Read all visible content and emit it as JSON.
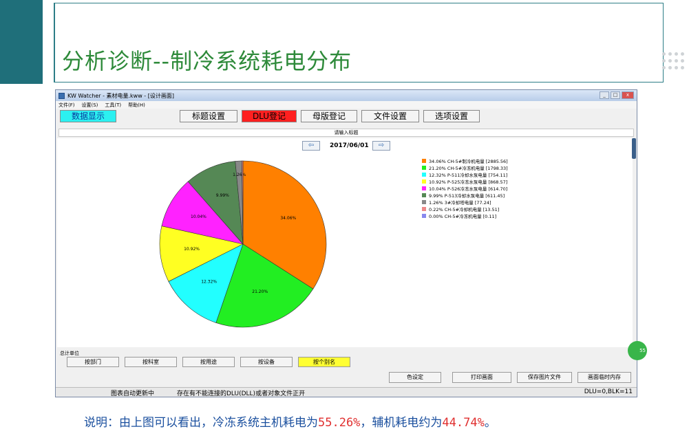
{
  "slide": {
    "title": "分析诊断--制冷系统耗电分布",
    "note_prefix": "说明：由上图可以看出，冷冻系统主机耗电为",
    "note_value1": "55.26%",
    "note_mid": "，辅机耗电约为",
    "note_value2": "44.74%",
    "note_suffix": "。"
  },
  "window": {
    "title": "KW Watcher - 素材电量.kww - [设计画面]",
    "controls": [
      "_",
      "□",
      "x"
    ],
    "menu": [
      "文件(F)",
      "设置(S)",
      "工具(T)",
      "帮助(H)"
    ],
    "toolbar": {
      "data_display": "数据显示",
      "title_settings": "标题设置",
      "dlu_register": "DLU登记",
      "master_register": "母版登记",
      "file_settings": "文件设置",
      "option_settings": "选项设置"
    },
    "hint": "请输入标题",
    "date": "2017/06/01",
    "prev_icon": "⇦",
    "next_icon": "⇨"
  },
  "chart_data": {
    "type": "pie",
    "slices": [
      {
        "label": "34.06% CH-5#制冷机电量 [2885.56]",
        "value": 34.06,
        "pct_label": "34.06%",
        "color": "#ff8000"
      },
      {
        "label": "21.20% CH-5#冷冻机电量 [1798.33]",
        "value": 21.2,
        "pct_label": "21.20%",
        "color": "#22ee22"
      },
      {
        "label": "12.32% P-511冷却水泵电量 [754.11]",
        "value": 12.32,
        "pct_label": "12.32%",
        "color": "#22ffff"
      },
      {
        "label": "10.92% P-525冷冻水泵电量 [868.57]",
        "value": 10.92,
        "pct_label": "10.92%",
        "color": "#ffff22"
      },
      {
        "label": "10.04% P-526冷冻水泵电量 [614.70]",
        "value": 10.04,
        "pct_label": "10.04%",
        "color": "#ff22ff"
      },
      {
        "label": "9.99% P-513冷却水泵电量 [611.45]",
        "value": 9.99,
        "pct_label": "9.99%",
        "color": "#558855"
      },
      {
        "label": "1.26% 3#冷却塔电量 [77.24]",
        "value": 1.26,
        "pct_label": "1.26%",
        "color": "#888888"
      },
      {
        "label": "0.22% CH-5#冷却机电量 [13.51]",
        "value": 0.22,
        "pct_label": "0.22%",
        "color": "#ee8888"
      },
      {
        "label": "0.00% CH-5#冷冻机电量 [0.11]",
        "value": 0.0,
        "pct_label": "0.00%",
        "color": "#8888ee"
      }
    ]
  },
  "bottom": {
    "group_label": "总计单位",
    "group_buttons": [
      "按部门",
      "按科室",
      "按用途",
      "按设备",
      "按个别名"
    ],
    "action_buttons": [
      "色设定",
      "打印画面",
      "保存图片文件",
      "画面临时内存"
    ]
  },
  "status": {
    "left": "图表自动更新中",
    "middle": "存在有不能连接的DLU(DLL)或者对象文件正开",
    "right": "DLU=0,BLK=11"
  },
  "side_badge": "55"
}
